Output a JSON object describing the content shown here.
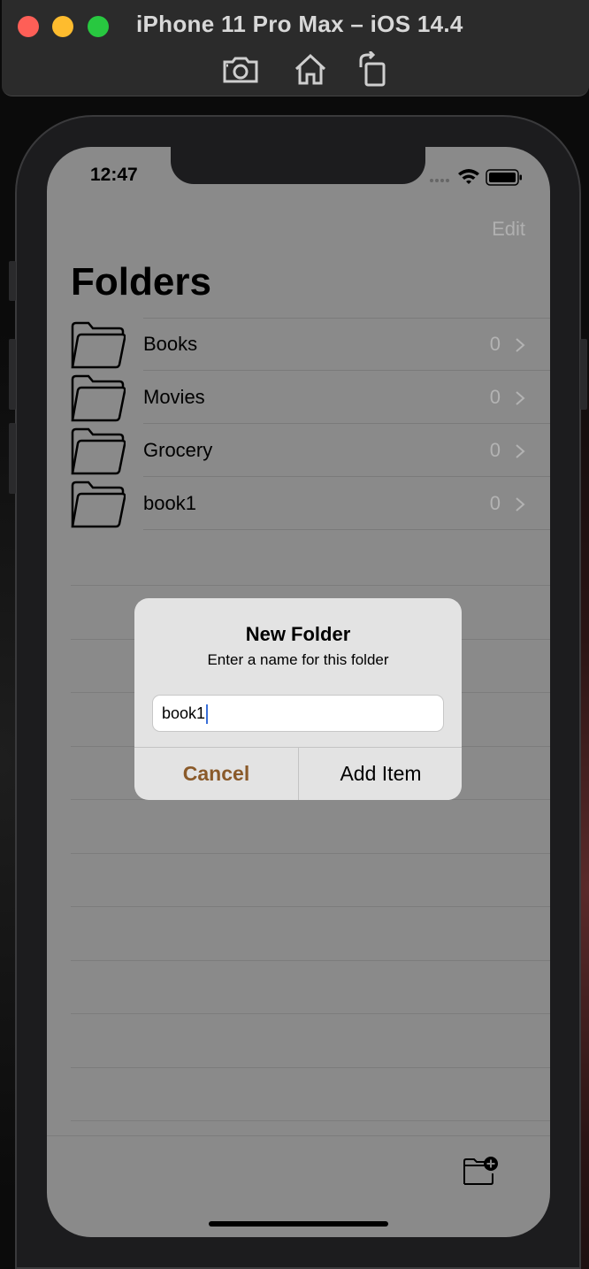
{
  "window": {
    "title": "iPhone 11 Pro Max – iOS 14.4"
  },
  "status_bar": {
    "time": "12:47"
  },
  "nav": {
    "edit_label": "Edit",
    "title": "Folders"
  },
  "folders": [
    {
      "name": "Books",
      "count": "0"
    },
    {
      "name": "Movies",
      "count": "0"
    },
    {
      "name": "Grocery",
      "count": "0"
    },
    {
      "name": "book1",
      "count": "0"
    }
  ],
  "alert": {
    "title": "New Folder",
    "message": "Enter a name for this folder",
    "input_value": "book1",
    "cancel_label": "Cancel",
    "confirm_label": "Add Item"
  },
  "colors": {
    "accent": "#8a5a2a",
    "overlay": "#8a8a8a"
  }
}
